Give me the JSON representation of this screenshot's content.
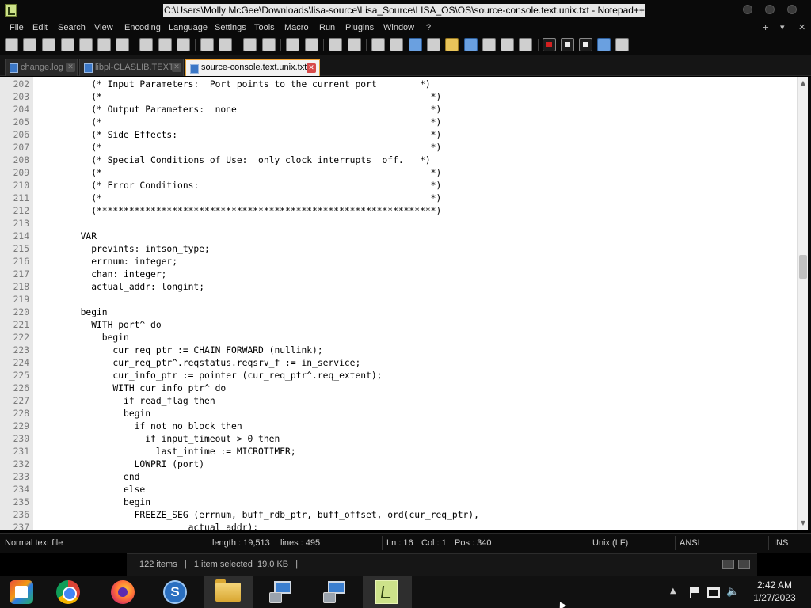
{
  "window": {
    "title": "C:\\Users\\Molly McGee\\Downloads\\lisa-source\\Lisa_Source\\LISA_OS\\OS\\source-console.text.unix.txt - Notepad++",
    "menu_controls": [
      "+",
      "▾",
      "✕"
    ]
  },
  "menu": [
    "File",
    "Edit",
    "Search",
    "View",
    "Encoding",
    "Language",
    "Settings",
    "Tools",
    "Macro",
    "Run",
    "Plugins",
    "Window",
    "?"
  ],
  "toolbar_icons": [
    "new-file-icon",
    "open-file-icon",
    "save-icon",
    "save-all-icon",
    "close-icon",
    "close-all-icon",
    "print-icon",
    "cut-icon",
    "copy-icon",
    "paste-icon",
    "undo-icon",
    "redo-icon",
    "find-icon",
    "replace-icon",
    "zoom-in-icon",
    "zoom-out-icon",
    "sync-vertical-icon",
    "sync-horizontal-icon",
    "word-wrap-icon",
    "show-all-chars-icon",
    "indent-guide-icon",
    "language-icon",
    "doc-map-icon",
    "function-list-icon",
    "folder-workspace-icon",
    "monitoring-icon",
    "record-macro-icon",
    "stop-record-icon",
    "play-macro-icon",
    "run-macro-multiple-icon",
    "save-macro-icon"
  ],
  "tabs": [
    {
      "label": "change.log",
      "active": false
    },
    {
      "label": "libpl-CLASLIB.TEXT",
      "active": false
    },
    {
      "label": "source-console.text.unix.txt",
      "active": true
    }
  ],
  "editor": {
    "lines": [
      {
        "n": "202",
        "text": "    (* Input Parameters:  Port points to the current port        *)"
      },
      {
        "n": "203",
        "text": "    (*                                                             *)"
      },
      {
        "n": "204",
        "text": "    (* Output Parameters:  none                                    *)"
      },
      {
        "n": "205",
        "text": "    (*                                                             *)"
      },
      {
        "n": "206",
        "text": "    (* Side Effects:                                               *)"
      },
      {
        "n": "207",
        "text": "    (*                                                             *)"
      },
      {
        "n": "208",
        "text": "    (* Special Conditions of Use:  only clock interrupts  off.   *)"
      },
      {
        "n": "209",
        "text": "    (*                                                             *)"
      },
      {
        "n": "210",
        "text": "    (* Error Conditions:                                           *)"
      },
      {
        "n": "211",
        "text": "    (*                                                             *)"
      },
      {
        "n": "212",
        "text": "    (***************************************************************)"
      },
      {
        "n": "213",
        "text": ""
      },
      {
        "n": "214",
        "text": "  VAR"
      },
      {
        "n": "215",
        "text": "    prevints: intson_type;"
      },
      {
        "n": "216",
        "text": "    errnum: integer;"
      },
      {
        "n": "217",
        "text": "    chan: integer;"
      },
      {
        "n": "218",
        "text": "    actual_addr: longint;"
      },
      {
        "n": "219",
        "text": ""
      },
      {
        "n": "220",
        "text": "  begin"
      },
      {
        "n": "221",
        "text": "    WITH port^ do"
      },
      {
        "n": "222",
        "text": "      begin"
      },
      {
        "n": "223",
        "text": "        cur_req_ptr := CHAIN_FORWARD (nullink);"
      },
      {
        "n": "224",
        "text": "        cur_req_ptr^.reqstatus.reqsrv_f := in_service;"
      },
      {
        "n": "225",
        "text": "        cur_info_ptr := pointer (cur_req_ptr^.req_extent);"
      },
      {
        "n": "226",
        "text": "        WITH cur_info_ptr^ do"
      },
      {
        "n": "227",
        "text": "          if read_flag then"
      },
      {
        "n": "228",
        "text": "          begin"
      },
      {
        "n": "229",
        "text": "            if not no_block then"
      },
      {
        "n": "230",
        "text": "              if input_timeout > 0 then"
      },
      {
        "n": "231",
        "text": "                last_intime := MICROTIMER;"
      },
      {
        "n": "232",
        "text": "            LOWPRI (port)"
      },
      {
        "n": "233",
        "text": "          end"
      },
      {
        "n": "234",
        "text": "          else"
      },
      {
        "n": "235",
        "text": "          begin"
      },
      {
        "n": "236",
        "text": "            FREEZE_SEG (errnum, buff_rdb_ptr, buff_offset, ord(cur_req_ptr),"
      },
      {
        "n": "237",
        "text": "                      actual_addr);"
      }
    ]
  },
  "status": {
    "type": "Normal text file",
    "length": "length : 19,513",
    "lines": "lines : 495",
    "ln": "Ln : 16",
    "col": "Col : 1",
    "pos": "Pos : 340",
    "eol": "Unix (LF)",
    "encoding": "ANSI",
    "mode": "INS"
  },
  "explorer": {
    "status": "122 items   |   1 item selected  19.0 KB   |"
  },
  "taskbar": {
    "apps": [
      "start-button",
      "chrome-icon",
      "firefox-icon",
      "skype-icon",
      "file-explorer-icon",
      "remote-desktop-icon",
      "remote-desktop-icon-2",
      "notepad-plus-plus-icon"
    ],
    "time": "2:42 AM",
    "date": "1/27/2023"
  },
  "colors": {
    "editor_bg": "#ffffff",
    "chrome_bg": "#0a0a0a",
    "active_tab_accent": "#f0a030",
    "line_number": "#7a7a7a"
  }
}
